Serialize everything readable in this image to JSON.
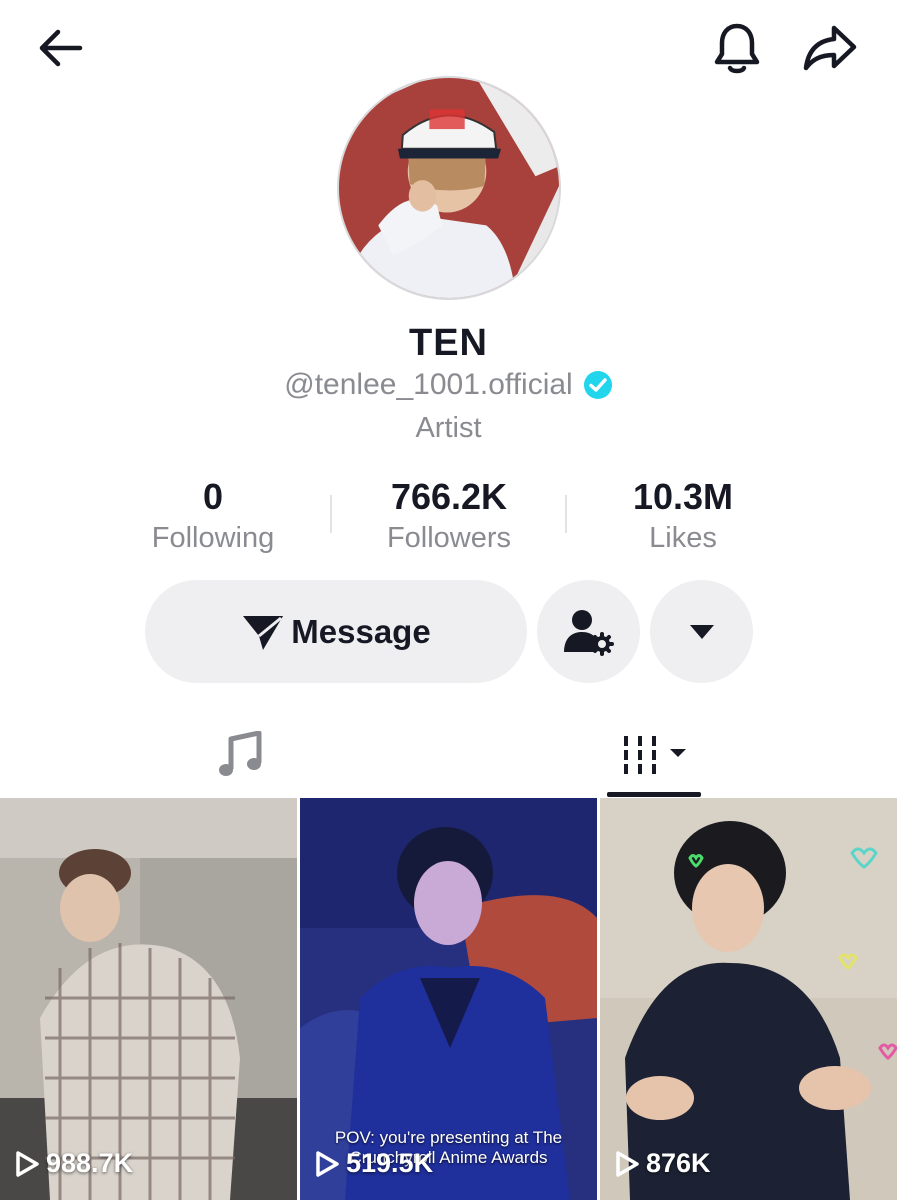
{
  "header": {
    "back_icon": "arrow-left-icon",
    "notification_icon": "bell-icon",
    "share_icon": "share-arrow-icon"
  },
  "profile": {
    "display_name": "TEN",
    "handle": "@tenlee_1001.official",
    "verified": true,
    "bio": "Artist"
  },
  "stats": {
    "following": {
      "value": "0",
      "label": "Following"
    },
    "followers": {
      "value": "766.2K",
      "label": "Followers"
    },
    "likes": {
      "value": "10.3M",
      "label": "Likes"
    }
  },
  "actions": {
    "message_label": "Message",
    "message_icon": "send-icon",
    "friend_icon": "user-settings-icon",
    "more_icon": "caret-down-icon"
  },
  "tabs": [
    {
      "name": "music",
      "icon": "music-note-icon",
      "active": false
    },
    {
      "name": "videos",
      "icon": "grid-filter-icon",
      "active": true
    }
  ],
  "videos": [
    {
      "views": "988.7K",
      "caption": ""
    },
    {
      "views": "519.5K",
      "caption": "POV: you're presenting at The Crunchyroll Anime Awards"
    },
    {
      "views": "876K",
      "caption": ""
    }
  ],
  "colors": {
    "primary_text": "#161823",
    "secondary_text": "#8a8b91",
    "button_bg": "#efeff1",
    "verified": "#20d5ec"
  }
}
